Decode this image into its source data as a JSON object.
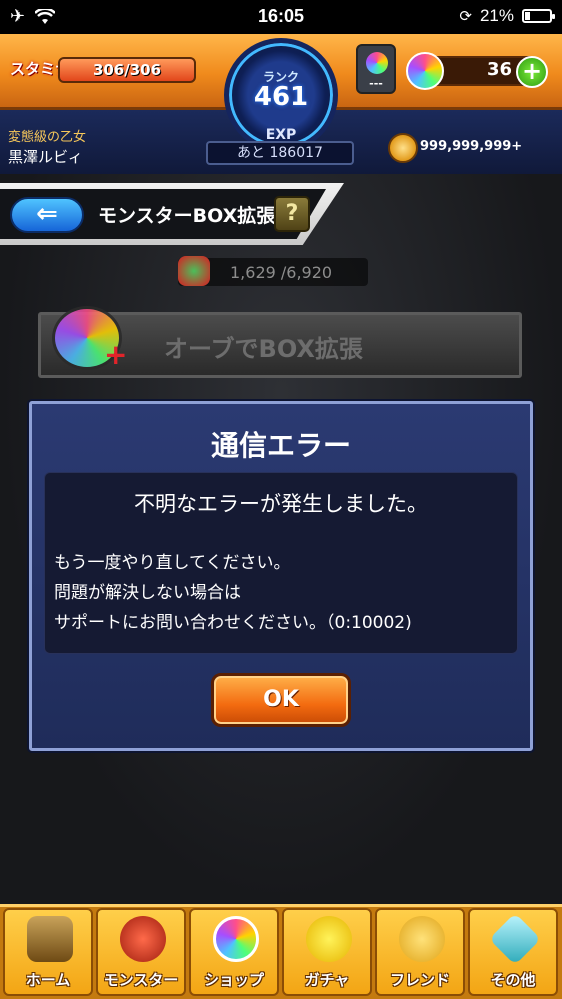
{
  "status_bar": {
    "time": "16:05",
    "battery": "21%",
    "battery_level": 0.21
  },
  "hud": {
    "stamina_label": "スタミナ",
    "stamina_value": "306/306",
    "stamina_level": 1.0,
    "rank_label": "ランク",
    "rank_value": "461",
    "exp_label": "EXP",
    "exp_remaining": "あと 186017",
    "orb_mini_value": "---",
    "orb_count": "36",
    "plus_label": "+",
    "player_title": "変態級の乙女",
    "player_name": "黒澤ルビィ",
    "coins": "999,999,999+"
  },
  "screen": {
    "back_label": "⇐",
    "title": "モンスターBOX拡張",
    "help_label": "?",
    "box_count": "1,629 /6,920",
    "expand_button": "オーブでBOX拡張",
    "expand_plus": "+"
  },
  "dialog": {
    "title": "通信エラー",
    "message": "不明なエラーが発生しました。",
    "lines": [
      "もう一度やり直してください。",
      "問題が解決しない場合は",
      "サポートにお問い合わせください。（0:10002)"
    ],
    "ok_label": "OK"
  },
  "nav": [
    {
      "label": "ホーム",
      "icon": "home-icon"
    },
    {
      "label": "モンスター",
      "icon": "monster-icon"
    },
    {
      "label": "ショップ",
      "icon": "shop-orb-icon"
    },
    {
      "label": "ガチャ",
      "icon": "gacha-egg-icon"
    },
    {
      "label": "フレンド",
      "icon": "friend-icon"
    },
    {
      "label": "その他",
      "icon": "other-icon"
    }
  ],
  "colors": {
    "hud_orange": "#f08a1c",
    "dialog_blue": "#2b3a72",
    "ok_orange": "#f36b10",
    "nav_gold": "#f3a514"
  }
}
